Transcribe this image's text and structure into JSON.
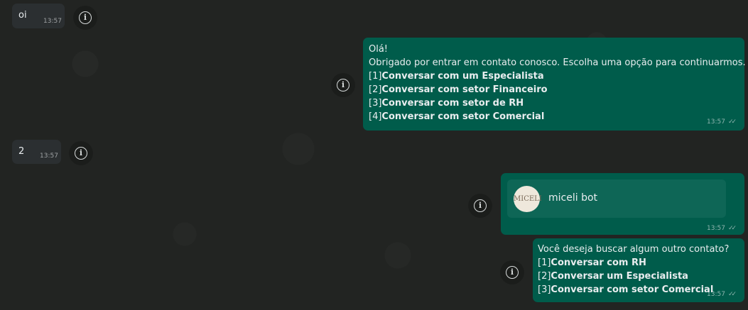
{
  "messages": [
    {
      "type": "incoming",
      "text": "oi",
      "time": "13:57"
    },
    {
      "type": "outgoing",
      "lines": [
        "Olá!",
        "Obrigado por entrar em contato conosco. Escolha uma opção para continuarmos.",
        "[1]Conversar com um Especialista",
        "[2]Conversar com setor Financeiro",
        "[3]Conversar com setor de RH",
        "[4]Conversar com setor Comercial"
      ],
      "time": "13:57",
      "status": "✓✓"
    },
    {
      "type": "incoming",
      "text": "2",
      "time": "13:57"
    },
    {
      "type": "outgoing-contact",
      "contact_name": "miceli bot",
      "avatar_text": "MICELI",
      "time": "13:57",
      "status": "✓✓"
    },
    {
      "type": "outgoing",
      "lines": [
        "Você deseja buscar algum outro contato?",
        "[1]Conversar com RH",
        "[2]Conversar um Especialista",
        "[3]Conversar com setor Comercial"
      ],
      "time": "13:57",
      "status": "✓✓"
    }
  ],
  "colors": {
    "background": "#222422",
    "incoming_bubble": "#2b2f31",
    "outgoing_bubble": "#005c4b"
  },
  "icons": {
    "info": "info-icon",
    "read_status": "double-check-icon"
  }
}
